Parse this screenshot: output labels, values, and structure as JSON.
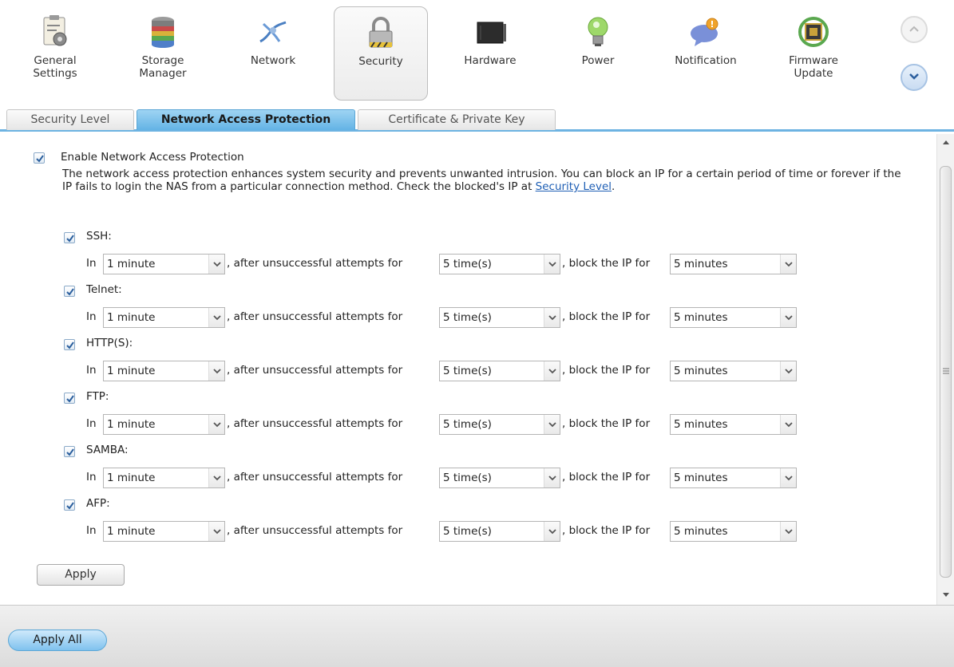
{
  "categories": [
    {
      "label1": "General",
      "label2": "Settings",
      "icon": "settings-icon"
    },
    {
      "label1": "Storage",
      "label2": "Manager",
      "icon": "storage-icon"
    },
    {
      "label1": "Network",
      "label2": "",
      "icon": "network-icon"
    },
    {
      "label1": "Security",
      "label2": "",
      "icon": "lock-icon"
    },
    {
      "label1": "Hardware",
      "label2": "",
      "icon": "hardware-icon"
    },
    {
      "label1": "Power",
      "label2": "",
      "icon": "power-bulb-icon"
    },
    {
      "label1": "Notification",
      "label2": "",
      "icon": "notification-icon"
    },
    {
      "label1": "Firmware",
      "label2": "Update",
      "icon": "firmware-icon"
    }
  ],
  "active_category": "Security",
  "tabs": [
    "Security Level",
    "Network Access Protection",
    "Certificate & Private Key"
  ],
  "active_tab": "Network Access Protection",
  "enable": {
    "label": "Enable Network Access Protection",
    "checked": true
  },
  "description": {
    "text": "The network access protection enhances system security and prevents unwanted intrusion. You can block an IP for a certain period of time or forever if the IP fails to login the NAS from a particular connection method. Check the blocked's IP at ",
    "link": "Security Level",
    "end": "."
  },
  "row_text": {
    "in": "In",
    "attempts": ", after unsuccessful attempts for",
    "block": ", block the IP for"
  },
  "protocols": [
    {
      "name": "SSH:",
      "checked": true,
      "period": "1 minute",
      "attempts": "5 time(s)",
      "block": "5 minutes"
    },
    {
      "name": "Telnet:",
      "checked": true,
      "period": "1 minute",
      "attempts": "5 time(s)",
      "block": "5 minutes"
    },
    {
      "name": "HTTP(S):",
      "checked": true,
      "period": "1 minute",
      "attempts": "5 time(s)",
      "block": "5 minutes"
    },
    {
      "name": "FTP:",
      "checked": true,
      "period": "1 minute",
      "attempts": "5 time(s)",
      "block": "5 minutes"
    },
    {
      "name": "SAMBA:",
      "checked": true,
      "period": "1 minute",
      "attempts": "5 time(s)",
      "block": "5 minutes"
    },
    {
      "name": "AFP:",
      "checked": true,
      "period": "1 minute",
      "attempts": "5 time(s)",
      "block": "5 minutes"
    }
  ],
  "buttons": {
    "apply": "Apply",
    "apply_all": "Apply All"
  },
  "colors": {
    "tab_active": "#63b3e5",
    "link": "#1f5fb5"
  }
}
